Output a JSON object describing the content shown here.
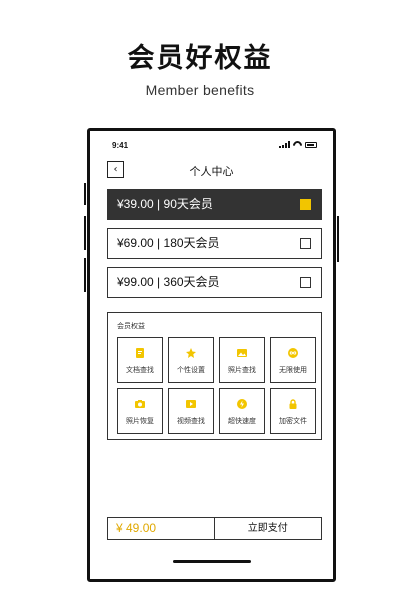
{
  "hero": {
    "title": "会员好权益",
    "subtitle": "Member benefits"
  },
  "status_bar": {
    "time": "9:41"
  },
  "nav": {
    "back_icon": "chevron-left-icon",
    "back_glyph": "‹",
    "title": "个人中心"
  },
  "plans": [
    {
      "price": "¥39.00",
      "duration": "90天会员",
      "selected": true
    },
    {
      "price": "¥69.00",
      "duration": "180天会员",
      "selected": false
    },
    {
      "price": "¥99.00",
      "duration": "360天会员",
      "selected": false
    }
  ],
  "plan_separator": "|",
  "benefits": {
    "title": "会员权益",
    "items": [
      {
        "label": "文档查找",
        "icon": "document-search-icon"
      },
      {
        "label": "个性设置",
        "icon": "personalize-icon"
      },
      {
        "label": "照片查找",
        "icon": "photo-icon"
      },
      {
        "label": "无限使用",
        "icon": "infinity-icon"
      },
      {
        "label": "照片恢复",
        "icon": "camera-icon"
      },
      {
        "label": "视频查找",
        "icon": "video-icon"
      },
      {
        "label": "超快速度",
        "icon": "lightning-icon"
      },
      {
        "label": "加密文件",
        "icon": "lock-icon"
      }
    ]
  },
  "payment": {
    "total": "¥ 49.00",
    "pay_label": "立即支付"
  },
  "colors": {
    "accent": "#f2c500",
    "selected_bg": "#333333",
    "price": "#e0a800"
  }
}
